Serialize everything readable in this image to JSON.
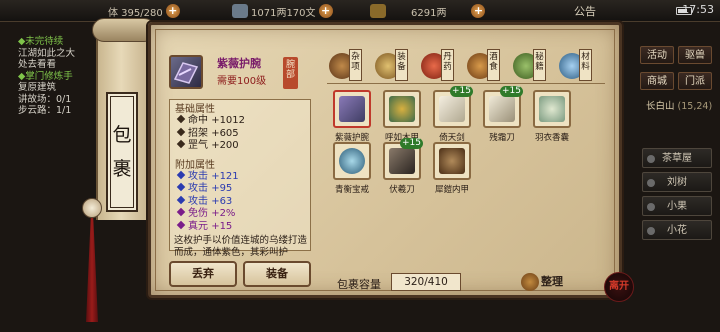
{
  "topbar": {
    "stamina": "体 395/280",
    "silver": "1071两170文",
    "gold": "6291两",
    "notice": "公告",
    "time": "17:53"
  },
  "quest": {
    "q1_title": "◆未完待续",
    "q1_line1": "江湖如此之大",
    "q1_line2": "处去看看",
    "q2_title": "◆掌门修炼手",
    "q2_line1": "复原建筑",
    "q2_line2": "讲故场：0/1",
    "q2_line3": "步云路：1/1"
  },
  "side": {
    "activity": "活动",
    "beast": "驱兽",
    "shop": "商城",
    "sect": "门派",
    "location": "长白山",
    "coords": "(15,24)",
    "npcs": [
      "茶草屋",
      "刘树",
      "小果",
      "小花"
    ]
  },
  "scroll": {
    "label": "包裹"
  },
  "selected": {
    "name": "紫薇护腕",
    "requirement": "需要100级",
    "seal": "腕部"
  },
  "attributes": {
    "base_title": "基础属性",
    "base": [
      {
        "label": "命中",
        "value": "+1012"
      },
      {
        "label": "招架",
        "value": "+605"
      },
      {
        "label": "罡气",
        "value": "+200"
      }
    ],
    "extra_title": "附加属性",
    "extra": [
      {
        "label": "攻击",
        "value": "+121"
      },
      {
        "label": "攻击",
        "value": "+95"
      },
      {
        "label": "攻击",
        "value": "+63"
      },
      {
        "label": "免伤",
        "value": "+2%"
      },
      {
        "label": "真元",
        "value": "+15"
      }
    ],
    "description": "这枚护手以价值连城的乌缕打造而成，通体紫色，其彩叫护"
  },
  "actions": {
    "discard": "丢弃",
    "equip": "装备"
  },
  "categories": [
    {
      "label": "杂项",
      "icon": "jar-icon",
      "color": "#8a5a2a"
    },
    {
      "label": "装备",
      "icon": "sword-icon",
      "color": "#b08840"
    },
    {
      "label": "丹药",
      "icon": "pill-icon",
      "color": "#c0442c"
    },
    {
      "label": "酒食",
      "icon": "food-icon",
      "color": "#a86a2a"
    },
    {
      "label": "秘籍",
      "icon": "book-icon",
      "color": "#5e8a3a"
    },
    {
      "label": "材料",
      "icon": "crystal-icon",
      "color": "#5a8ab0"
    }
  ],
  "items": [
    {
      "name": "紫薇护腕",
      "icon": "bracer-icon",
      "color": "#3f3d63",
      "plus": ""
    },
    {
      "name": "呼如木甲",
      "icon": "armor-icon",
      "color": "#3c6a4a",
      "plus": ""
    },
    {
      "name": "倚天剑",
      "icon": "sword-icon",
      "color": "#d8d0b8",
      "plus": "+15"
    },
    {
      "name": "残霜刀",
      "icon": "blade-icon",
      "color": "#cfc6ae",
      "plus": "+15"
    },
    {
      "name": "羽衣香囊",
      "icon": "pouch-icon",
      "color": "#b6c8b8",
      "plus": ""
    },
    {
      "name": "青衡宝戒",
      "icon": "ring-icon",
      "color": "#4a8aa6",
      "plus": ""
    },
    {
      "name": "伏羲刀",
      "icon": "blade-icon",
      "color": "#4a4038",
      "plus": "+15"
    },
    {
      "name": "犀鎧内甲",
      "icon": "armor-icon",
      "color": "#6a4a2a",
      "plus": ""
    }
  ],
  "capacity": {
    "label": "包裹容量",
    "value": "320/410"
  },
  "sort_label": "整理",
  "close_label": "离开"
}
